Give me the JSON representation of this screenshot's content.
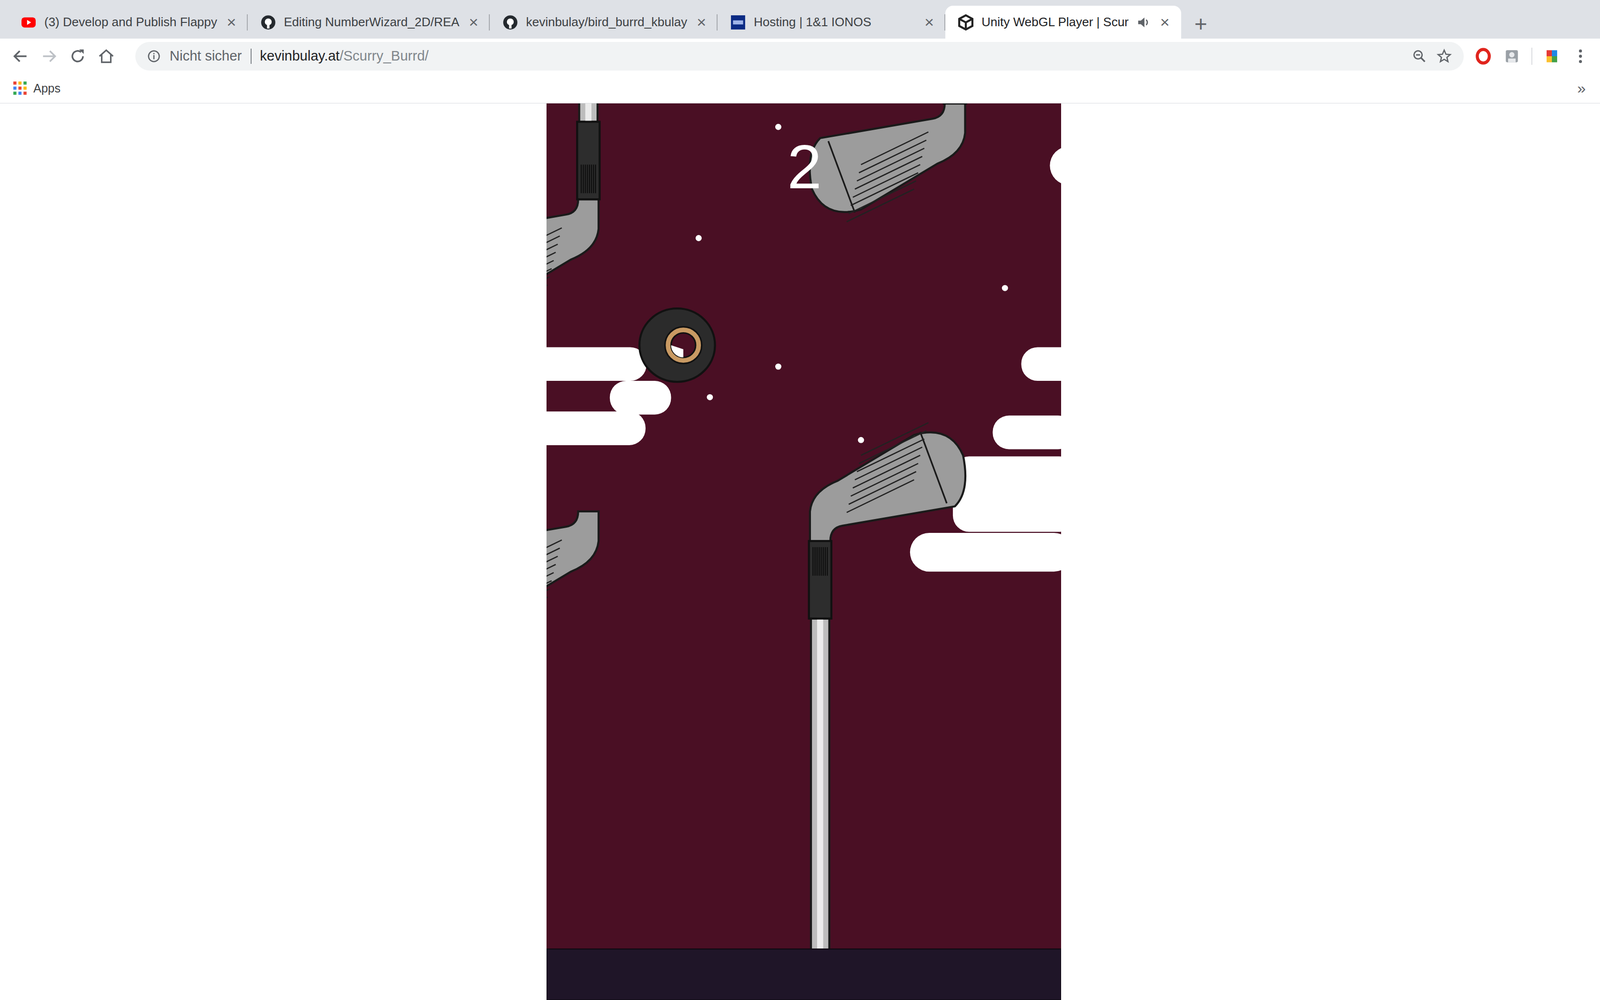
{
  "tabs": [
    {
      "label": "(3) Develop and Publish Flappy",
      "selected": false,
      "audio": false,
      "kind": "youtube",
      "close": "×"
    },
    {
      "label": "Editing NumberWizard_2D/REA",
      "selected": false,
      "audio": false,
      "kind": "github",
      "close": "×"
    },
    {
      "label": "kevinbulay/bird_burrd_kbulay",
      "selected": false,
      "audio": false,
      "kind": "github",
      "close": "×"
    },
    {
      "label": "Hosting | 1&1 IONOS",
      "selected": false,
      "audio": false,
      "kind": "ionos",
      "close": "×"
    },
    {
      "label": "Unity WebGL Player | Scur",
      "selected": true,
      "audio": true,
      "kind": "unity",
      "close": "×"
    }
  ],
  "new_tab": "+",
  "address_bar": {
    "security": "Nicht sicher",
    "domain": "kevinbulay.at",
    "path": "/Scurry_Burrd/"
  },
  "bookmarks": {
    "items": [
      "Apps"
    ],
    "overflow": "»"
  },
  "game": {
    "score": "2"
  }
}
